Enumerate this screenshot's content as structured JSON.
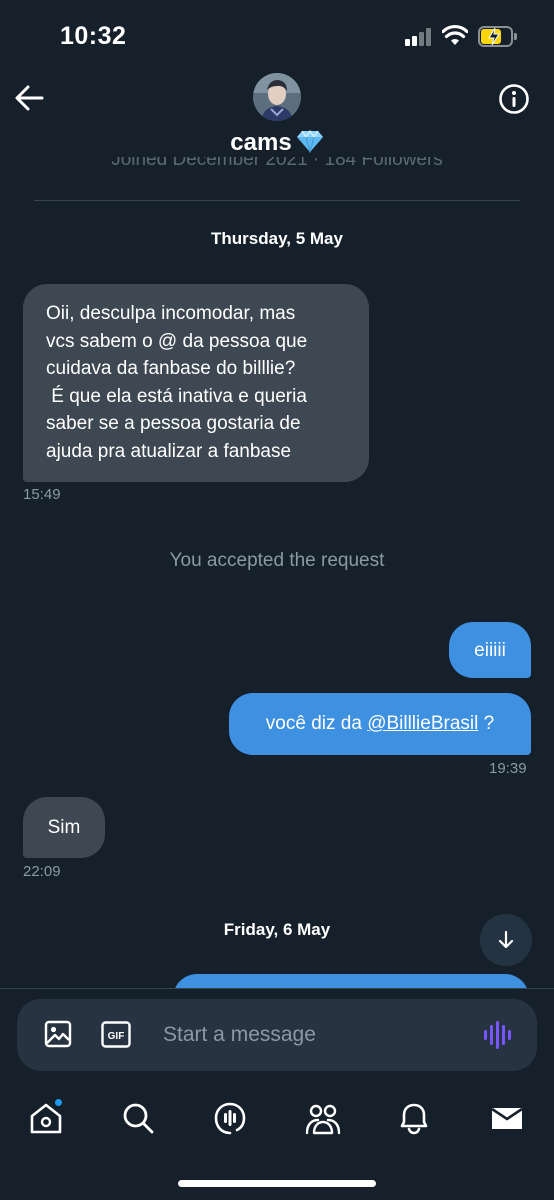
{
  "status_bar": {
    "time": "10:32"
  },
  "header": {
    "name": "cams",
    "profile_subtext": "Joined December 2021 · 184 Followers"
  },
  "conversation": {
    "date_1": "Thursday, 5 May",
    "msg_1": {
      "lines": [
        "Oii, desculpa incomodar, mas",
        "vcs sabem o @ da pessoa que",
        "cuidava da fanbase do billlie?",
        " É que ela está inativa e queria",
        "saber se a pessoa gostaria de",
        "ajuda pra atualizar a fanbase"
      ],
      "time": "15:49"
    },
    "system_note": "You accepted the request",
    "msg_2": {
      "text": "eiiiii"
    },
    "msg_3": {
      "prefix": "você diz da ",
      "mention": "@BilllieBrasil",
      "suffix": " ?",
      "time": "19:39"
    },
    "msg_4": {
      "text": "Sim",
      "time": "22:09"
    },
    "date_2": "Friday, 6 May"
  },
  "composer": {
    "placeholder": "Start a message"
  },
  "tab_bar": {
    "items": [
      {
        "icon": "home-icon",
        "has_notification": true
      },
      {
        "icon": "search-icon"
      },
      {
        "icon": "spaces-icon"
      },
      {
        "icon": "communities-icon"
      },
      {
        "icon": "bell-icon"
      },
      {
        "icon": "mail-icon",
        "active": true
      }
    ]
  },
  "colors": {
    "background": "#15202b",
    "incoming_bubble": "#3d4852",
    "outgoing_bubble": "#3e90e1",
    "muted_text": "#8b98a5",
    "voice_accent": "#7856ff",
    "battery_fill": "#ffd60a"
  }
}
